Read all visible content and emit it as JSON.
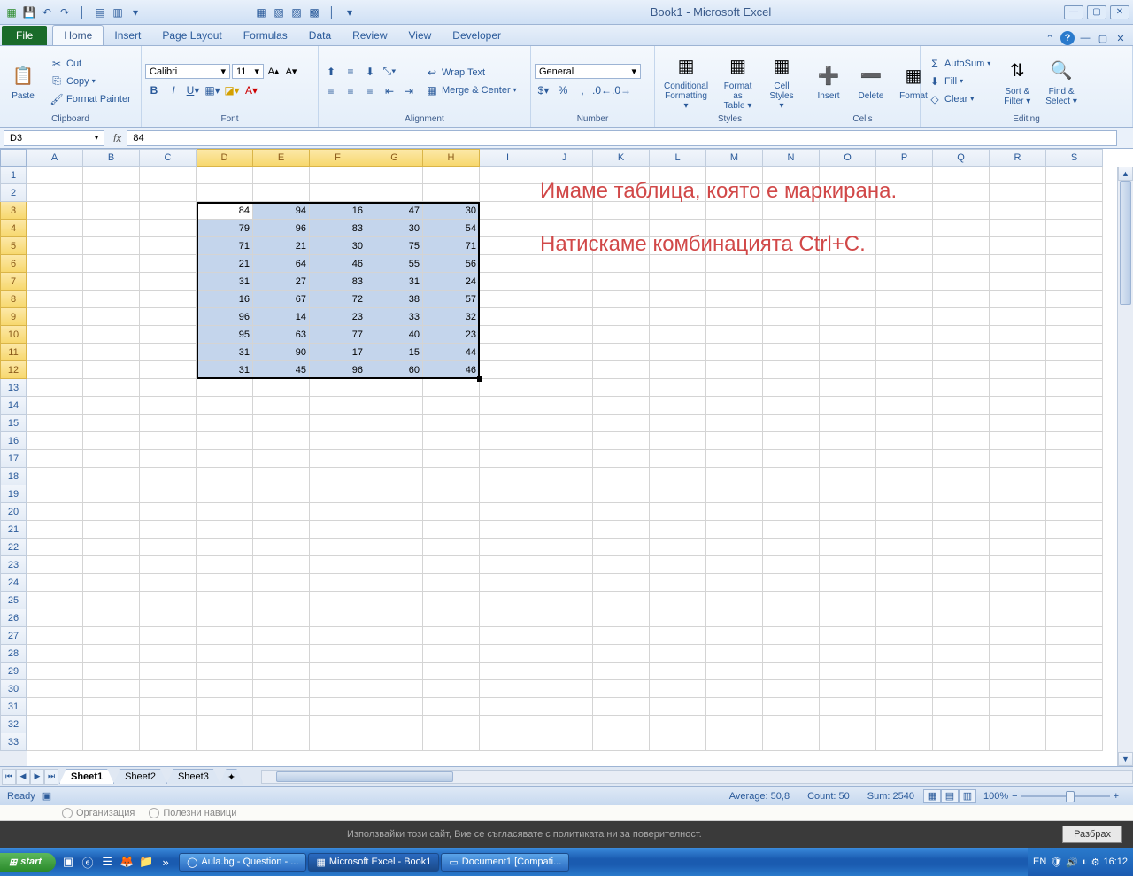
{
  "title": "Book1 - Microsoft Excel",
  "tabs": [
    "File",
    "Home",
    "Insert",
    "Page Layout",
    "Formulas",
    "Data",
    "Review",
    "View",
    "Developer"
  ],
  "activeTab": "Home",
  "clipboard": {
    "label": "Clipboard",
    "paste": "Paste",
    "cut": "Cut",
    "copy": "Copy",
    "painter": "Format Painter"
  },
  "font": {
    "label": "Font",
    "name": "Calibri",
    "size": "11"
  },
  "alignment": {
    "label": "Alignment",
    "wrap": "Wrap Text",
    "merge": "Merge & Center"
  },
  "number": {
    "label": "Number",
    "format": "General"
  },
  "styles": {
    "label": "Styles",
    "cond": "Conditional\nFormatting",
    "table": "Format\nas Table",
    "cell": "Cell\nStyles"
  },
  "cells": {
    "label": "Cells",
    "insert": "Insert",
    "delete": "Delete",
    "format": "Format"
  },
  "editing": {
    "label": "Editing",
    "autosum": "AutoSum",
    "fill": "Fill",
    "clear": "Clear",
    "sort": "Sort &\nFilter",
    "find": "Find &\nSelect"
  },
  "namebox": "D3",
  "formula": "84",
  "cols": [
    "A",
    "B",
    "C",
    "D",
    "E",
    "F",
    "G",
    "H",
    "I",
    "J",
    "K",
    "L",
    "M",
    "N",
    "O",
    "P",
    "Q",
    "R",
    "S"
  ],
  "selCols": [
    "D",
    "E",
    "F",
    "G",
    "H"
  ],
  "rows": [
    1,
    2,
    3,
    4,
    5,
    6,
    7,
    8,
    9,
    10,
    11,
    12,
    13,
    14,
    15,
    16,
    17,
    18,
    19,
    20,
    21,
    22,
    23,
    24,
    25,
    26,
    27,
    28,
    29,
    30,
    31,
    32,
    33
  ],
  "selRows": [
    3,
    4,
    5,
    6,
    7,
    8,
    9,
    10,
    11,
    12
  ],
  "data": [
    [
      84,
      94,
      16,
      47,
      30
    ],
    [
      79,
      96,
      83,
      30,
      54
    ],
    [
      71,
      21,
      30,
      75,
      71
    ],
    [
      21,
      64,
      46,
      55,
      56
    ],
    [
      31,
      27,
      83,
      31,
      24
    ],
    [
      16,
      67,
      72,
      38,
      57
    ],
    [
      96,
      14,
      23,
      33,
      32
    ],
    [
      95,
      63,
      77,
      40,
      23
    ],
    [
      31,
      90,
      17,
      15,
      44
    ],
    [
      31,
      45,
      96,
      60,
      46
    ]
  ],
  "annot1": "Имаме таблица, която е маркирана.",
  "annot2": "Натискаме комбинацията Ctrl+C.",
  "sheets": [
    "Sheet1",
    "Sheet2",
    "Sheet3"
  ],
  "status": {
    "ready": "Ready",
    "avg": "Average: 50,8",
    "count": "Count: 50",
    "sum": "Sum: 2540",
    "zoom": "100%"
  },
  "under": [
    "Организация",
    "Полезни навици"
  ],
  "darktext": "Използвайки този сайт, Вие се съгласявате с политиката ни за поверителност.",
  "darkbtn": "Разбрах",
  "taskbtns": [
    {
      "label": "Aula.bg - Question - ...",
      "ico": "◯"
    },
    {
      "label": "Microsoft Excel - Book1",
      "ico": "▦"
    },
    {
      "label": "Document1 [Compati...",
      "ico": "▭"
    }
  ],
  "clock": "16:12",
  "lang": "EN",
  "startLabel": "start"
}
